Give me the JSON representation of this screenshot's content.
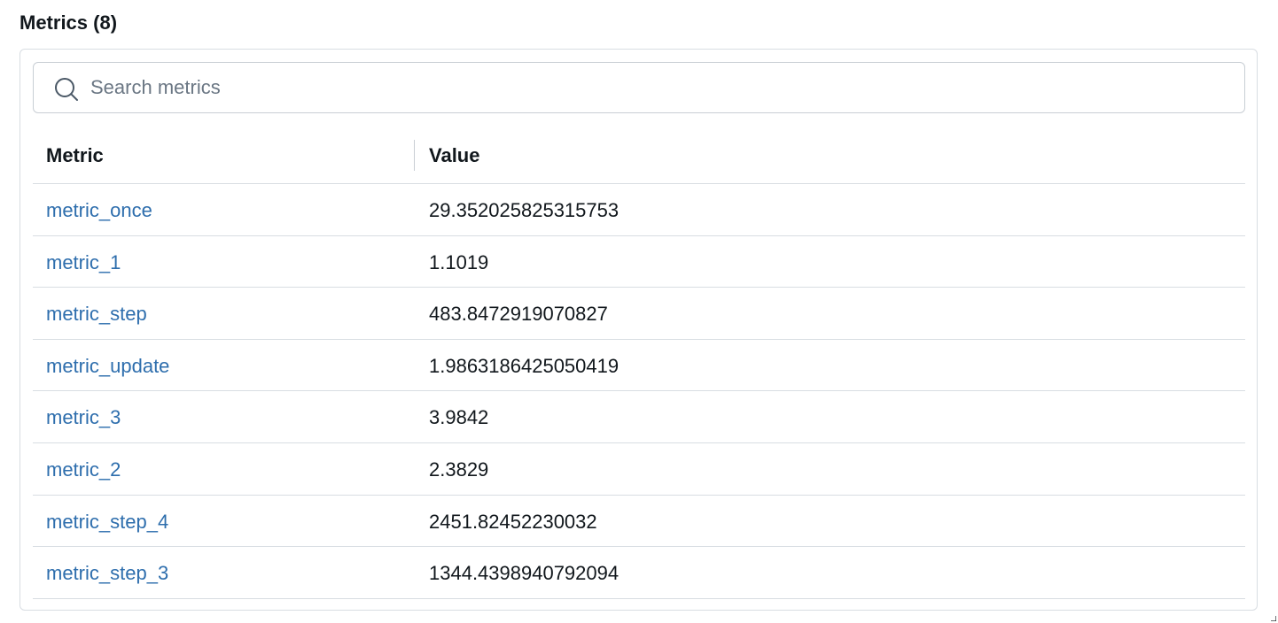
{
  "section": {
    "title": "Metrics (8)"
  },
  "search": {
    "placeholder": "Search metrics",
    "value": ""
  },
  "table": {
    "columns": [
      "Metric",
      "Value"
    ],
    "rows": [
      {
        "metric": "metric_once",
        "value": "29.352025825315753"
      },
      {
        "metric": "metric_1",
        "value": "1.1019"
      },
      {
        "metric": "metric_step",
        "value": "483.8472919070827"
      },
      {
        "metric": "metric_update",
        "value": "1.9863186425050419"
      },
      {
        "metric": "metric_3",
        "value": "3.9842"
      },
      {
        "metric": "metric_2",
        "value": "2.3829"
      },
      {
        "metric": "metric_step_4",
        "value": "2451.82452230032"
      },
      {
        "metric": "metric_step_3",
        "value": "1344.4398940792094"
      }
    ]
  },
  "colors": {
    "link": "#2e6ead",
    "text": "#11171c",
    "border": "#d8dde2",
    "placeholder": "#6b7784"
  }
}
